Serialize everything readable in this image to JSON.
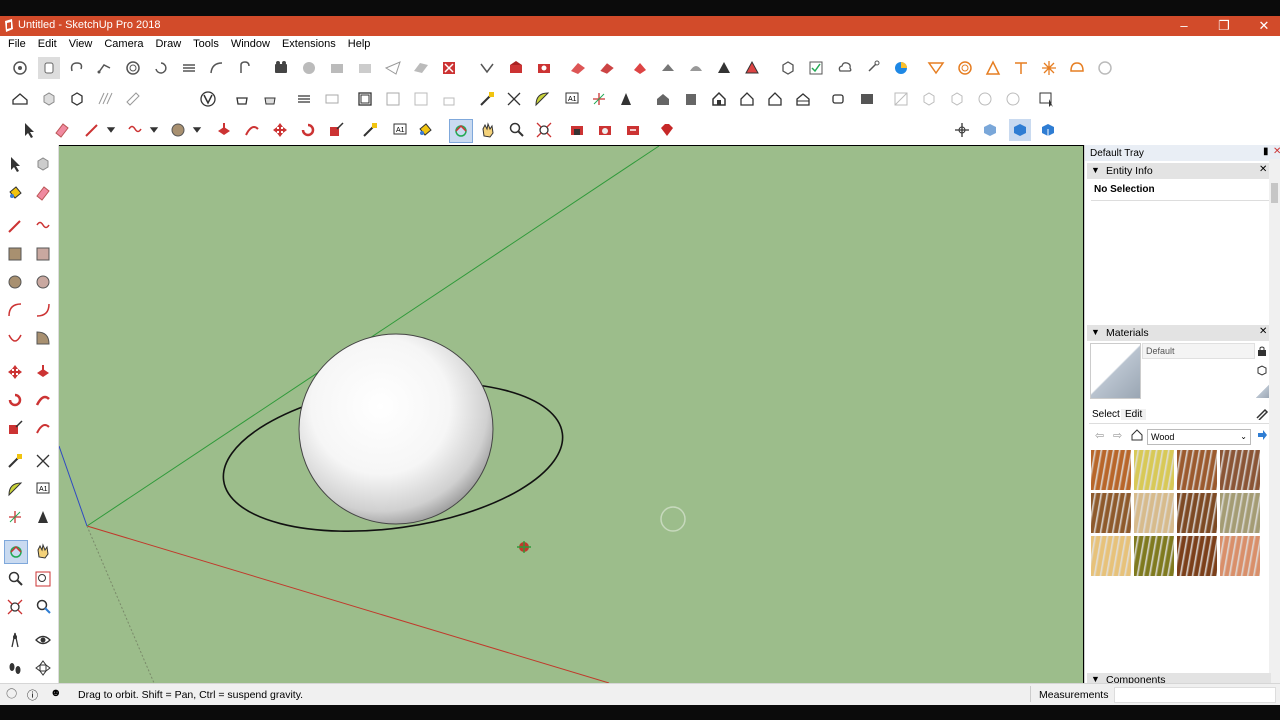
{
  "window": {
    "title": "Untitled - SketchUp Pro 2018"
  },
  "menu": [
    "File",
    "Edit",
    "View",
    "Camera",
    "Draw",
    "Tools",
    "Window",
    "Extensions",
    "Help"
  ],
  "tray": {
    "title": "Default Tray",
    "entity_info": {
      "label": "Entity Info",
      "status": "No Selection"
    },
    "materials": {
      "label": "Materials",
      "current": "Default",
      "tab_select": "Select",
      "tab_edit": "Edit",
      "library": "Wood",
      "swatch_colors": [
        "#b8662a",
        "#d8c957",
        "#9b5a2e",
        "#8a5536",
        "#8e5a2c",
        "#d7bb8c",
        "#7d4a24",
        "#a49c74",
        "#e7c27a",
        "#7f7a1f",
        "#7b3f1a",
        "#d98f6a"
      ]
    },
    "components_label": "Components"
  },
  "status": {
    "message": "Drag to orbit. Shift = Pan, Ctrl = suspend gravity.",
    "measurements_label": "Measurements"
  },
  "colors": {
    "accent": "#d24b2a",
    "viewport": "#9cbd8b"
  }
}
